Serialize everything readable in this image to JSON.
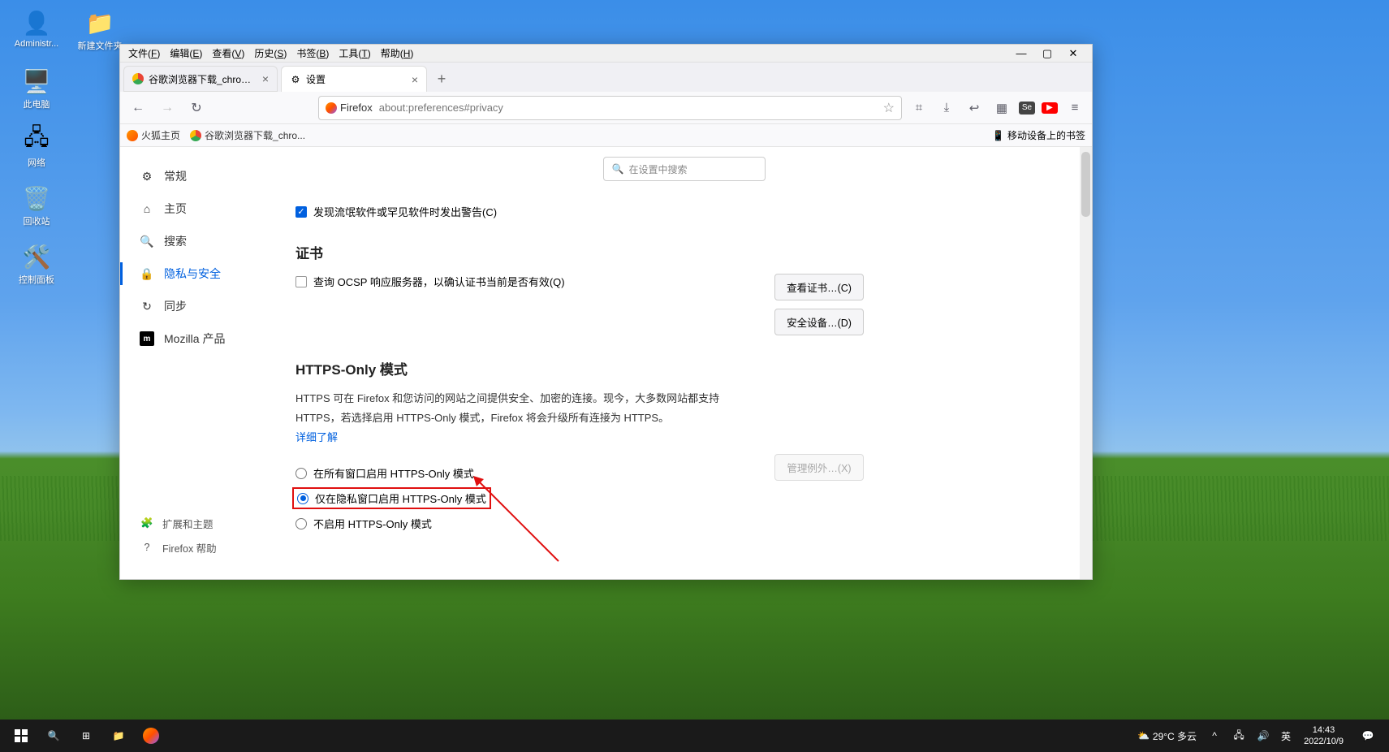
{
  "desktop": {
    "icons": [
      {
        "label": "Administr...",
        "glyph": "👤"
      },
      {
        "label": "新建文件夹",
        "glyph": "📁"
      },
      {
        "label": "此电脑",
        "glyph": "🖥️"
      },
      {
        "label": "网络",
        "glyph": "🖧"
      },
      {
        "label": "回收站",
        "glyph": "🗑️"
      },
      {
        "label": "控制面板",
        "glyph": "🛠️"
      }
    ]
  },
  "menubar": {
    "items": [
      {
        "pre": "文件(",
        "u": "F",
        "post": ")"
      },
      {
        "pre": "编辑(",
        "u": "E",
        "post": ")"
      },
      {
        "pre": "查看(",
        "u": "V",
        "post": ")"
      },
      {
        "pre": "历史(",
        "u": "S",
        "post": ")"
      },
      {
        "pre": "书签(",
        "u": "B",
        "post": ")"
      },
      {
        "pre": "工具(",
        "u": "T",
        "post": ")"
      },
      {
        "pre": "帮助(",
        "u": "H",
        "post": ")"
      }
    ]
  },
  "tabs": {
    "t1_label": "谷歌浏览器下载_chrome浏览器",
    "t2_label": "设置"
  },
  "nav": {
    "identity": "Firefox",
    "url": "about:preferences#privacy"
  },
  "bookmarks": {
    "b1": "火狐主页",
    "b2": "谷歌浏览器下载_chro...",
    "right": "移动设备上的书签"
  },
  "sidebar": {
    "general": "常规",
    "home": "主页",
    "search": "搜索",
    "privacy": "隐私与安全",
    "sync": "同步",
    "mozilla": "Mozilla 产品",
    "ext": "扩展和主题",
    "help": "Firefox 帮助"
  },
  "settings": {
    "search_placeholder": "在设置中搜索",
    "warn_label": "发现流氓软件或罕见软件时发出警告(C)",
    "cert_title": "证书",
    "cert_ocsp": "查询 OCSP 响应服务器，以确认证书当前是否有效(Q)",
    "cert_view_btn": "查看证书…(C)",
    "cert_devices_btn": "安全设备…(D)",
    "https_title": "HTTPS-Only 模式",
    "https_desc1": "HTTPS 可在 Firefox 和您访问的网站之间提供安全、加密的连接。现今，大多数网站都支持",
    "https_desc2": "HTTPS，若选择启用 HTTPS-Only 模式，Firefox 将会升级所有连接为 HTTPS。",
    "https_more": "详细了解",
    "https_opt1": "在所有窗口启用 HTTPS-Only 模式",
    "https_opt2": "仅在隐私窗口启用 HTTPS-Only 模式",
    "https_opt3": "不启用 HTTPS-Only 模式",
    "https_manage_btn": "管理例外…(X)"
  },
  "taskbar": {
    "weather": "29°C 多云",
    "ime": "英",
    "time": "14:43",
    "date": "2022/10/9"
  }
}
